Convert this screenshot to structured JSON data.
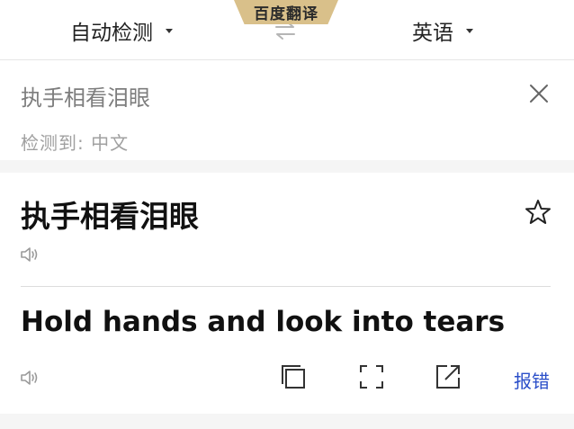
{
  "header": {
    "brand": "百度翻译",
    "source_lang": "自动检测",
    "target_lang": "英语"
  },
  "input": {
    "text": "执手相看泪眼",
    "detected_label": "检测到:",
    "detected_lang": "中文"
  },
  "result": {
    "source_text": "执手相看泪眼",
    "translation": "Hold hands and look into tears",
    "report_label": "报错"
  },
  "colors": {
    "brand": "#d9c08a",
    "link": "#2b4fc9"
  },
  "icons": [
    "chevron-down-icon",
    "swap-icon",
    "close-icon",
    "star-icon",
    "speaker-icon",
    "copy-icon",
    "fullscreen-icon",
    "share-icon"
  ]
}
